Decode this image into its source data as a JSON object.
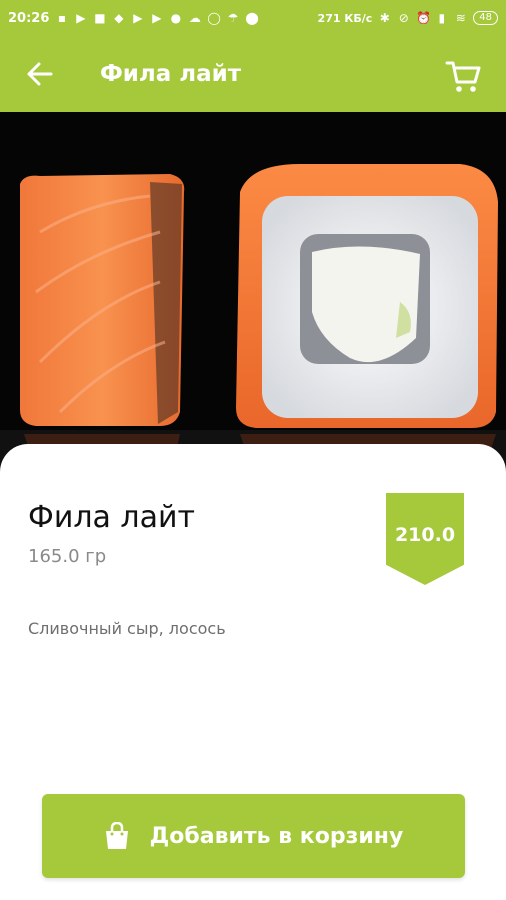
{
  "status_bar": {
    "time": "20:26",
    "net_speed": "271 КБ/с",
    "battery": "48"
  },
  "app_bar": {
    "title": "Фила лайт"
  },
  "product": {
    "name": "Фила лайт",
    "weight": "165.0 гр",
    "price": "210.0",
    "description": "Сливочный сыр, лосось"
  },
  "actions": {
    "add_to_cart": "Добавить в корзину"
  },
  "colors": {
    "accent": "#a5c93b"
  },
  "icons": {
    "back": "arrow-left-icon",
    "cart": "cart-icon",
    "bag": "shopping-bag-icon"
  }
}
